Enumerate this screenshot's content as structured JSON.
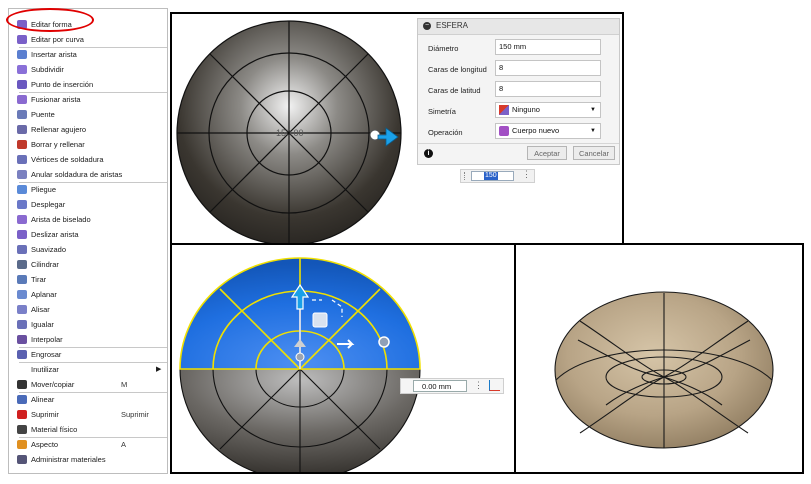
{
  "menu": {
    "items": [
      {
        "label": "Editar forma",
        "icon": "edit-form-icon"
      },
      {
        "label": "Editar por curva",
        "icon": "edit-curve-icon"
      },
      {
        "label": "Insertar arista",
        "icon": "insert-edge-icon"
      },
      {
        "label": "Subdividir",
        "icon": "subdivide-icon"
      },
      {
        "label": "Punto de inserción",
        "icon": "insert-point-icon"
      },
      {
        "label": "Fusionar arista",
        "icon": "merge-edge-icon"
      },
      {
        "label": "Puente",
        "icon": "bridge-icon"
      },
      {
        "label": "Rellenar agujero",
        "icon": "fill-hole-icon"
      },
      {
        "label": "Borrar y rellenar",
        "icon": "erase-fill-icon"
      },
      {
        "label": "Vértices de soldadura",
        "icon": "weld-vertices-icon"
      },
      {
        "label": "Anular soldadura de aristas",
        "icon": "unweld-edges-icon"
      },
      {
        "label": "Pliegue",
        "icon": "crease-icon"
      },
      {
        "label": "Desplegar",
        "icon": "uncrease-icon"
      },
      {
        "label": "Arista de biselado",
        "icon": "bevel-edge-icon"
      },
      {
        "label": "Deslizar arista",
        "icon": "slide-edge-icon"
      },
      {
        "label": "Suavizado",
        "icon": "smooth-icon"
      },
      {
        "label": "Cilindrar",
        "icon": "cylindrify-icon"
      },
      {
        "label": "Tirar",
        "icon": "pull-icon"
      },
      {
        "label": "Aplanar",
        "icon": "flatten-icon"
      },
      {
        "label": "Alisar",
        "icon": "straighten-icon"
      },
      {
        "label": "Igualar",
        "icon": "match-icon"
      },
      {
        "label": "Interpolar",
        "icon": "interpolate-icon"
      },
      {
        "label": "Engrosar",
        "icon": "thicken-icon"
      },
      {
        "label": "Inutilizar",
        "icon": "freeze-icon"
      },
      {
        "label": "Mover/copiar",
        "icon": "move-icon",
        "shortcut": "M"
      },
      {
        "label": "Alinear",
        "icon": "align-icon"
      },
      {
        "label": "Suprimir",
        "icon": "delete-icon",
        "shortcut": "Suprimir"
      },
      {
        "label": "Material físico",
        "icon": "material-icon"
      },
      {
        "label": "Aspecto",
        "icon": "appearance-icon",
        "shortcut": "A"
      },
      {
        "label": "Administrar materiales",
        "icon": "manage-materials-icon"
      }
    ]
  },
  "dialog": {
    "title": "ESFERA",
    "fields": [
      {
        "label": "Diámetro",
        "value": "150 mm"
      },
      {
        "label": "Caras de longitud",
        "value": "8"
      },
      {
        "label": "Caras de latitud",
        "value": "8"
      }
    ],
    "symmetry": {
      "label": "Simetría",
      "value": "Ninguno"
    },
    "operation": {
      "label": "Operación",
      "value": "Cuerpo nuevo"
    },
    "ok_label": "Aceptar",
    "cancel_label": "Cancelar"
  },
  "diameter_input_value": "150",
  "sphere_overlay_text": "150.00",
  "move_distance_value": "0.00 mm",
  "colors": {
    "highlight_ring": "#e00000",
    "selection_blue": "#1f6fe0",
    "edge_yellow": "#f0e000",
    "arrow_blue": "#1aa0e8",
    "sphere_dark": "#3a3630",
    "sphere_tan": "#b8a486"
  }
}
